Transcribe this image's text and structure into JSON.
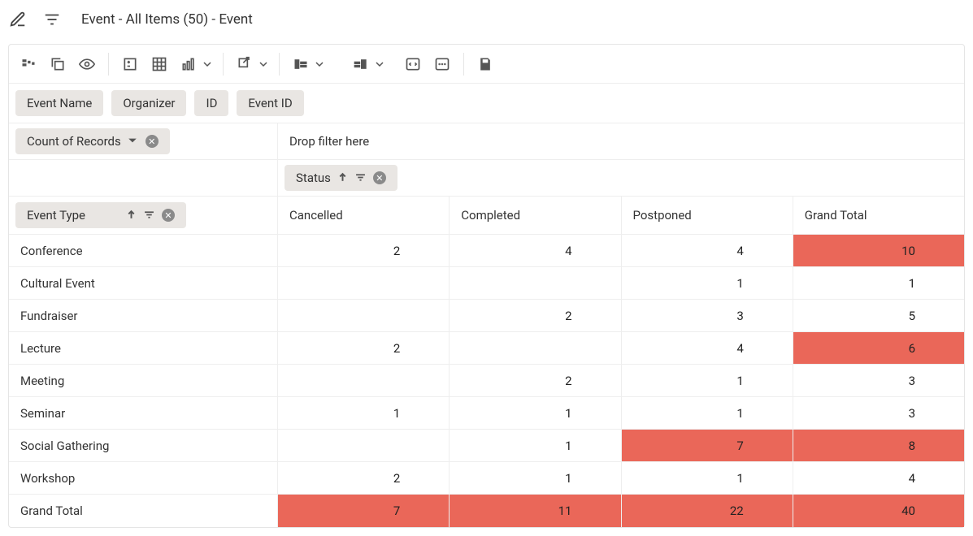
{
  "header": {
    "title": "Event - All Items (50) - Event"
  },
  "field_chips": [
    "Event Name",
    "Organizer",
    "ID",
    "Event ID"
  ],
  "measure_chip": "Count of Records",
  "filter_drop_hint": "Drop filter here",
  "column_chip": "Status",
  "row_chip": "Event Type",
  "columns": [
    "Cancelled",
    "Completed",
    "Postponed",
    "Grand Total"
  ],
  "rows": [
    {
      "label": "Conference",
      "values": [
        "2",
        "4",
        "4",
        "10"
      ],
      "hl": [
        false,
        false,
        false,
        true
      ]
    },
    {
      "label": "Cultural Event",
      "values": [
        "",
        "",
        "1",
        "1"
      ],
      "hl": [
        false,
        false,
        false,
        false
      ]
    },
    {
      "label": "Fundraiser",
      "values": [
        "",
        "2",
        "3",
        "5"
      ],
      "hl": [
        false,
        false,
        false,
        false
      ]
    },
    {
      "label": "Lecture",
      "values": [
        "2",
        "",
        "4",
        "6"
      ],
      "hl": [
        false,
        false,
        false,
        true
      ]
    },
    {
      "label": "Meeting",
      "values": [
        "",
        "2",
        "1",
        "3"
      ],
      "hl": [
        false,
        false,
        false,
        false
      ]
    },
    {
      "label": "Seminar",
      "values": [
        "1",
        "1",
        "1",
        "3"
      ],
      "hl": [
        false,
        false,
        false,
        false
      ]
    },
    {
      "label": "Social Gathering",
      "values": [
        "",
        "1",
        "7",
        "8"
      ],
      "hl": [
        false,
        false,
        true,
        true
      ]
    },
    {
      "label": "Workshop",
      "values": [
        "2",
        "1",
        "1",
        "4"
      ],
      "hl": [
        false,
        false,
        false,
        false
      ]
    },
    {
      "label": "Grand Total",
      "values": [
        "7",
        "11",
        "22",
        "40"
      ],
      "hl": [
        true,
        true,
        true,
        true
      ]
    }
  ],
  "chart_data": {
    "type": "table",
    "row_field": "Event Type",
    "column_field": "Status",
    "measure": "Count of Records",
    "columns": [
      "Cancelled",
      "Completed",
      "Postponed",
      "Grand Total"
    ],
    "rows": [
      "Conference",
      "Cultural Event",
      "Fundraiser",
      "Lecture",
      "Meeting",
      "Seminar",
      "Social Gathering",
      "Workshop",
      "Grand Total"
    ],
    "data": [
      [
        2,
        4,
        4,
        10
      ],
      [
        null,
        null,
        1,
        1
      ],
      [
        null,
        2,
        3,
        5
      ],
      [
        2,
        null,
        4,
        6
      ],
      [
        null,
        2,
        1,
        3
      ],
      [
        1,
        1,
        1,
        3
      ],
      [
        null,
        1,
        7,
        8
      ],
      [
        2,
        1,
        1,
        4
      ],
      [
        7,
        11,
        22,
        40
      ]
    ]
  }
}
